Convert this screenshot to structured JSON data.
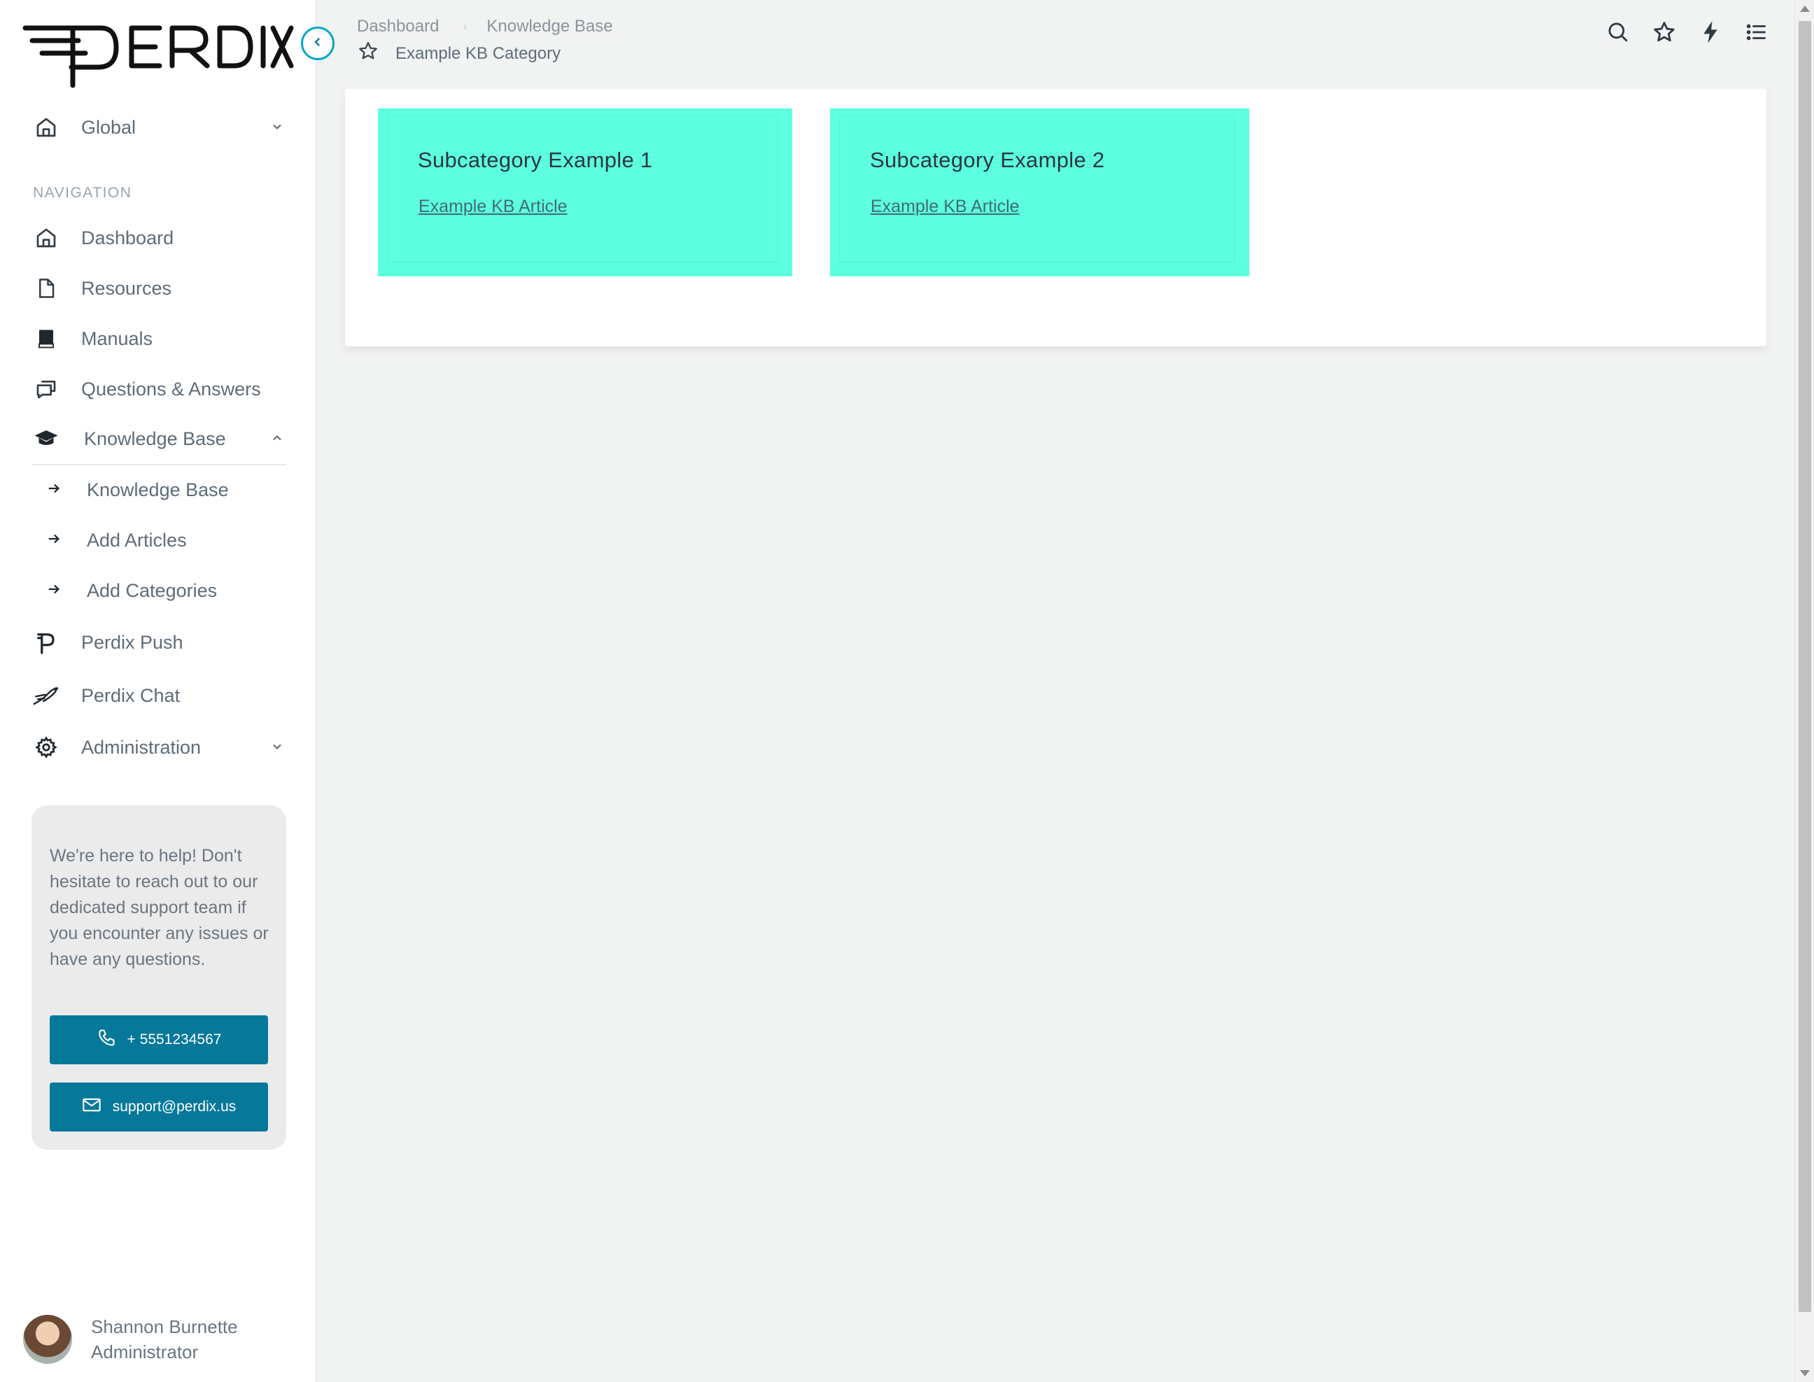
{
  "brand": {
    "logo_text": "PERDIX"
  },
  "sidebar": {
    "scope": {
      "label": "Global",
      "icon": "home-icon"
    },
    "section_label": "NAVIGATION",
    "items": [
      {
        "label": "Dashboard",
        "icon": "home-icon"
      },
      {
        "label": "Resources",
        "icon": "document-icon"
      },
      {
        "label": "Manuals",
        "icon": "book-icon"
      },
      {
        "label": "Questions & Answers",
        "icon": "chat-bubbles-icon"
      },
      {
        "label": "Knowledge Base",
        "icon": "graduation-cap-icon",
        "expanded": true
      },
      {
        "label": "Perdix Push",
        "icon": "perdix-p-icon"
      },
      {
        "label": "Perdix Chat",
        "icon": "bird-icon"
      },
      {
        "label": "Administration",
        "icon": "gear-icon"
      }
    ],
    "kb_subitems": [
      {
        "label": "Knowledge Base",
        "icon": "arrow-right-icon"
      },
      {
        "label": "Add Articles",
        "icon": "arrow-right-icon"
      },
      {
        "label": "Add Categories",
        "icon": "arrow-right-icon"
      }
    ],
    "support": {
      "message": "We're here to help! Don't hesitate to reach out to our dedicated support team if you encounter any issues or have any questions.",
      "phone": "+ 5551234567",
      "email": "support@perdix.us"
    },
    "user": {
      "name": "Shannon Burnette",
      "role": "Administrator"
    }
  },
  "header": {
    "breadcrumb": [
      "Dashboard",
      "Knowledge Base"
    ],
    "page_title": "Example KB Category",
    "icons": [
      "search-icon",
      "star-icon",
      "lightning-icon",
      "list-icon"
    ]
  },
  "main": {
    "tiles": [
      {
        "title": "Subcategory Example 1",
        "link": "Example KB Article"
      },
      {
        "title": "Subcategory Example 2",
        "link": "Example KB Article"
      }
    ],
    "tile_color": "#5cffdf"
  },
  "colors": {
    "accent": "#06789a",
    "collapse_ring": "#0aa6c9",
    "background": "#f1f2f2"
  }
}
